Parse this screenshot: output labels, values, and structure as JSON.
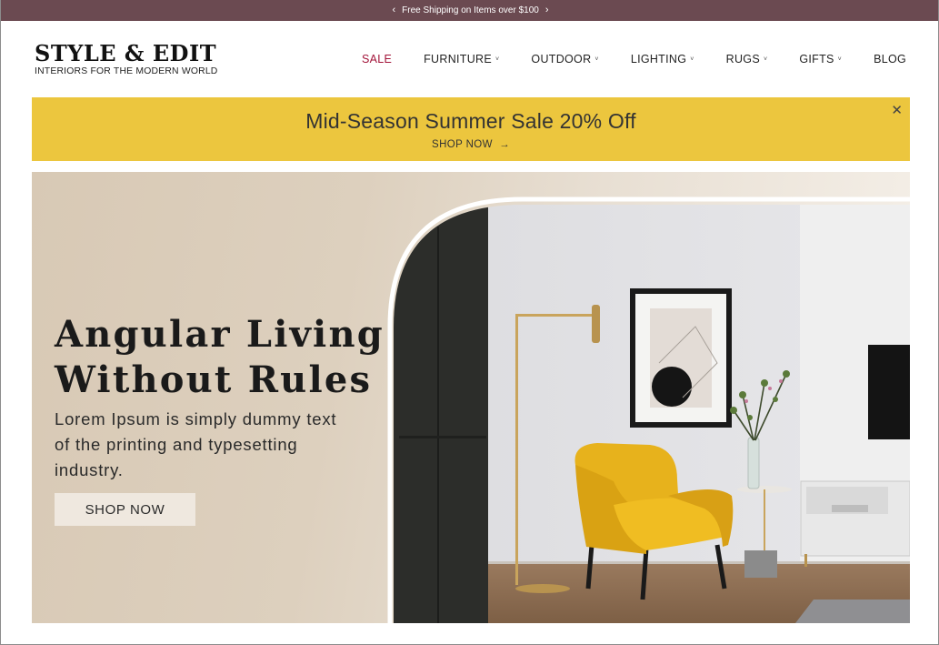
{
  "topbar": {
    "message": "Free Shipping on Items over $100",
    "prev_icon": "chevron-left-icon",
    "next_icon": "chevron-right-icon",
    "background": "#6b4a51"
  },
  "header": {
    "brand": "STYLE & EDIT",
    "tagline": "INTERIORS FOR THE MODERN WORLD",
    "nav": [
      {
        "label": "SALE",
        "dropdown": false
      },
      {
        "label": "FURNITURE",
        "dropdown": true
      },
      {
        "label": "OUTDOOR",
        "dropdown": true
      },
      {
        "label": "LIGHTING",
        "dropdown": true
      },
      {
        "label": "RUGS",
        "dropdown": true
      },
      {
        "label": "GIFTS",
        "dropdown": true
      },
      {
        "label": "BLOG",
        "dropdown": false
      }
    ],
    "sale_color": "#a3153a"
  },
  "promo": {
    "headline": "Mid-Season Summer Sale 20% Off",
    "cta": "SHOP NOW",
    "cta_icon": "arrow-right-icon",
    "close_icon": "close-icon",
    "background": "#ecc63e"
  },
  "hero": {
    "title_line1": "Angular Living",
    "title_line2": "Without Rules",
    "description": "Lorem Ipsum is simply dummy text of the printing and typesetting industry.",
    "button": "SHOP NOW",
    "image_subject": "living-room-yellow-armchair-image"
  }
}
